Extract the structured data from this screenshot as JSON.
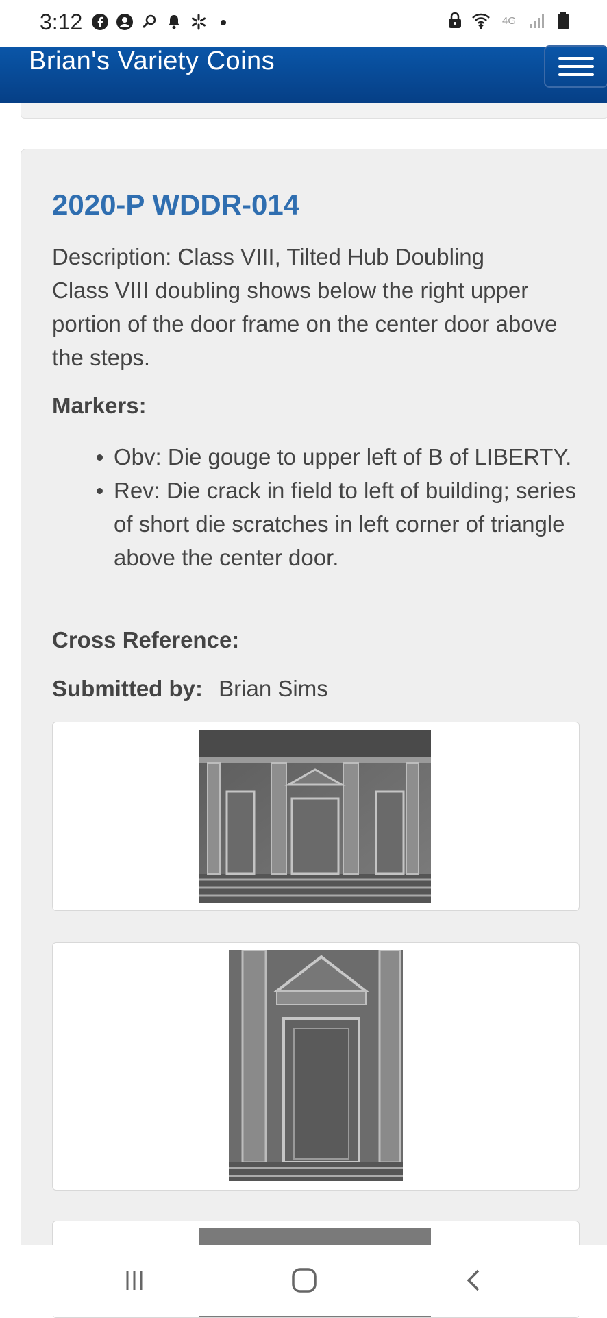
{
  "status": {
    "time": "3:12",
    "left_icons": [
      "facebook-icon",
      "account-icon",
      "search-icon",
      "bell-icon",
      "walmart-icon",
      "dot-icon"
    ],
    "right_icons": [
      "lock-icon",
      "wifi-icon",
      "network-4g-icon",
      "signal-icon",
      "battery-icon"
    ],
    "network_label": "4G"
  },
  "navbar": {
    "brand": "Brian's Variety Coins",
    "menu_icon": "hamburger-menu-icon"
  },
  "entry": {
    "title": "2020-P WDDR-014",
    "description_line1": "Description: Class VIII, Tilted Hub Doubling",
    "description_line2": "Class VIII doubling shows below the right upper portion of the door frame on the center door above the steps.",
    "markers_label": "Markers:",
    "markers": [
      "Obv:  Die gouge to upper left of B of LIBERTY.",
      "Rev:  Die crack in field to left of building; series of short die scratches in left corner of triangle above the center door."
    ],
    "cross_reference_label": "Cross Reference:",
    "submitted_label": "Submitted by:",
    "submitted_value": "Brian Sims"
  },
  "images": [
    {
      "name": "reverse-building-closeup"
    },
    {
      "name": "center-door-closeup"
    },
    {
      "name": "third-closeup"
    }
  ],
  "nav": {
    "recents_icon": "recents-icon",
    "home_icon": "home-icon",
    "back_icon": "back-icon"
  }
}
